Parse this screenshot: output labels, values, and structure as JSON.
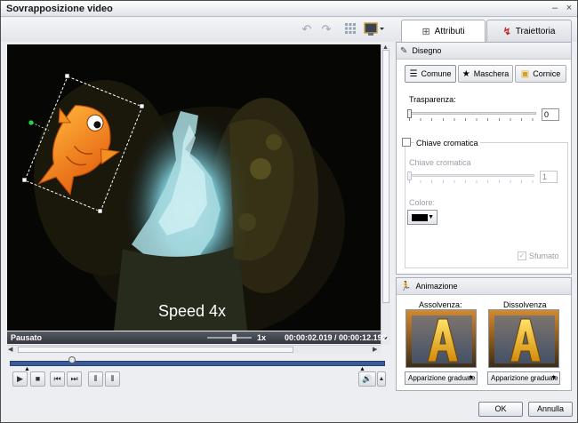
{
  "window": {
    "title": "Sovrapposizione video",
    "minimize_glyph": "–",
    "close_glyph": "×"
  },
  "toolbar": {
    "icons": [
      "undo-icon",
      "redo-icon",
      "grid-icon",
      "monitor-icon"
    ]
  },
  "tabs": [
    {
      "label": "Attributi",
      "active": true,
      "icon": "attributes-icon"
    },
    {
      "label": "Traiettoria",
      "active": false,
      "icon": "trajectory-icon"
    }
  ],
  "video": {
    "caption": "Speed 4x",
    "status": "Pausato",
    "speed": "1x",
    "time": "00:00:02.019 / 00:00:12.192"
  },
  "drawing": {
    "header": "Disegno",
    "subtabs": [
      "Comune",
      "Maschera",
      "Cornice"
    ],
    "transparency_label": "Trasparenza:",
    "transparency_value": "0",
    "chroma_checkbox_label": "Chiave cromatica",
    "chroma_label": "Chiave cromatica",
    "chroma_value": "1",
    "color_label": "Colore:",
    "color_value": "#000000",
    "blur_label": "Sfumato"
  },
  "animation": {
    "header": "Animazione",
    "fade_in_label": "Assolvenza:",
    "fade_out_label": "Dissolvenza",
    "fade_in_option": "Apparizione graduale",
    "fade_out_option": "Apparizione graduale"
  },
  "buttons": {
    "ok": "OK",
    "cancel": "Annulla"
  },
  "colors": {
    "accent_blue": "#3a5b9a",
    "fish_orange": "#f07a10",
    "water_cyan": "#9ad4dc"
  }
}
